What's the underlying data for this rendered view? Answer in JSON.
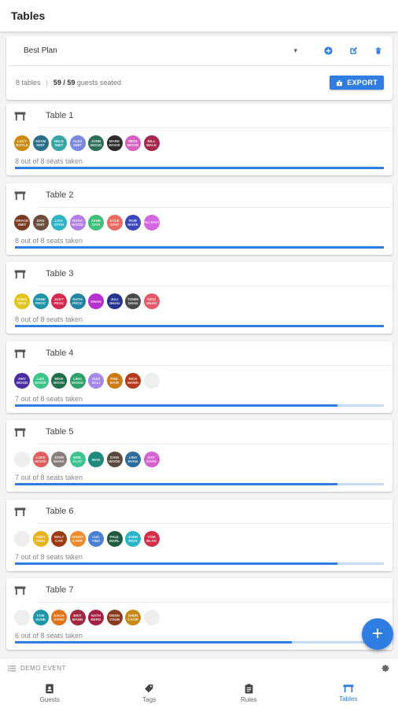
{
  "app": {
    "title": "Tables"
  },
  "plan": {
    "name": "Best Plan"
  },
  "summary": {
    "tables": "8 tables",
    "separator": "|",
    "seated": "59 / 59",
    "seated_suffix": "guests seated",
    "export_label": "EXPORT"
  },
  "tables": [
    {
      "name": "Table 1",
      "status": "8 out of 8 seats taken",
      "progress": 1.0,
      "seats": [
        {
          "label": "LUCY BOYLE",
          "color": "#cc8a10"
        },
        {
          "label": "ADAM SMIT",
          "color": "#2a6f88"
        },
        {
          "label": "HELE SMIT",
          "color": "#3aa5a5"
        },
        {
          "label": "ALEX SMIT",
          "color": "#7b88df"
        },
        {
          "label": "JOHN WOOD",
          "color": "#2d6f5b"
        },
        {
          "label": "MARK WOOD",
          "color": "#2a2a2a"
        },
        {
          "label": "MIRA WOOD",
          "color": "#d860c0"
        },
        {
          "label": "BILL WALK",
          "color": "#a5284a"
        }
      ]
    },
    {
      "name": "Table 2",
      "status": "8 out of 8 seats taken",
      "progress": 1.0,
      "seats": [
        {
          "label": "GRACE SMIT",
          "color": "#7a3a22"
        },
        {
          "label": "DAN SMIT",
          "color": "#6b4e3d"
        },
        {
          "label": "LISA STAN",
          "color": "#2eb3c7"
        },
        {
          "label": "ROSA WOOD",
          "color": "#b17ee8"
        },
        {
          "label": "JANE DAVI",
          "color": "#3fbf7c"
        },
        {
          "label": "KYLE DAVI",
          "color": "#e96b62"
        },
        {
          "label": "ROB MAKE",
          "color": "#3b47b8"
        },
        {
          "label": "ALI DAVI",
          "color": "#d467e0"
        }
      ]
    },
    {
      "name": "Table 3",
      "status": "8 out of 8 seats taken",
      "progress": 1.0,
      "seats": [
        {
          "label": "GREG REVI",
          "color": "#e2c420"
        },
        {
          "label": "ANNE PROC",
          "color": "#1f93a7"
        },
        {
          "label": "JUDY PROC",
          "color": "#d4284e"
        },
        {
          "label": "NATH PROC",
          "color": "#2385a3"
        },
        {
          "label": "DRAN",
          "color": "#b730d0"
        },
        {
          "label": "JULI SHAN",
          "color": "#26348f"
        },
        {
          "label": "TOMM SHAN",
          "color": "#4a4a4a"
        },
        {
          "label": "KEVI SHAN",
          "color": "#e25a6a"
        }
      ]
    },
    {
      "name": "Table 4",
      "status": "7 out of 8 seats taken",
      "progress": 0.875,
      "seats": [
        {
          "label": "AMY WOOD",
          "color": "#4a2ea0"
        },
        {
          "label": "LIZZ WOOD",
          "color": "#3cc38a"
        },
        {
          "label": "MIKE WOOD",
          "color": "#1e6c4a"
        },
        {
          "label": "LINO WOOD",
          "color": "#2ea06a"
        },
        {
          "label": "SUZI ELLI",
          "color": "#a887e8"
        },
        {
          "label": "PHIL BAIR",
          "color": "#d07a16"
        },
        {
          "label": "RICK MANN",
          "color": "#b23b1b"
        },
        {
          "label": "",
          "color": ""
        }
      ]
    },
    {
      "name": "Table 5",
      "status": "7 out of 8 seats taken",
      "progress": 0.875,
      "seats": [
        {
          "label": "",
          "color": ""
        },
        {
          "label": "LUKE WOOD",
          "color": "#e05d5d"
        },
        {
          "label": "JOHN MARA",
          "color": "#8a7e7a"
        },
        {
          "label": "EMIL CLAY",
          "color": "#3cc390"
        },
        {
          "label": "MAN",
          "color": "#1d8a7c"
        },
        {
          "label": "DANI WOOD",
          "color": "#5b4a3b"
        },
        {
          "label": "LINA EVAN",
          "color": "#2c6d9a"
        },
        {
          "label": "KAT EVAN",
          "color": "#d763d0"
        }
      ]
    },
    {
      "name": "Table 6",
      "status": "7 out of 8 seats taken",
      "progress": 0.875,
      "seats": [
        {
          "label": "",
          "color": ""
        },
        {
          "label": "ANDY KING",
          "color": "#e6b31a"
        },
        {
          "label": "WALT CAR",
          "color": "#9c3a12"
        },
        {
          "label": "SANDY CARR",
          "color": "#ef8a2a"
        },
        {
          "label": "LUC TINA",
          "color": "#4a7fd6"
        },
        {
          "label": "PAUL MARL",
          "color": "#1f5a3f"
        },
        {
          "label": "JOHN RICH",
          "color": "#2bb3c9"
        },
        {
          "label": "TOM BLAN",
          "color": "#d62c4a"
        }
      ]
    },
    {
      "name": "Table 7",
      "status": "6 out of 8 seats taken",
      "progress": 0.75,
      "seats": [
        {
          "label": "",
          "color": ""
        },
        {
          "label": "TOM SONE",
          "color": "#1d96a8"
        },
        {
          "label": "KACH GARD",
          "color": "#e0731a"
        },
        {
          "label": "BRIT MANN",
          "color": "#a3273e"
        },
        {
          "label": "NATH BERG",
          "color": "#a21f43"
        },
        {
          "label": "DENN YOUN",
          "color": "#8a3b1f"
        },
        {
          "label": "SHER CAOR",
          "color": "#c88a16"
        },
        {
          "label": "",
          "color": ""
        }
      ]
    }
  ],
  "fab": {
    "label": "+"
  },
  "event": {
    "name": "DEMO EVENT"
  },
  "nav": [
    {
      "label": "Guests",
      "icon": "contact-book-icon",
      "active": false
    },
    {
      "label": "Tags",
      "icon": "tag-icon",
      "active": false
    },
    {
      "label": "Rules",
      "icon": "clipboard-icon",
      "active": false
    },
    {
      "label": "Tables",
      "icon": "table-icon",
      "active": true
    }
  ],
  "colors": {
    "accent": "#2f7de1",
    "progress_track": "#c5dbf7",
    "empty_seat": "#eeeeee"
  }
}
